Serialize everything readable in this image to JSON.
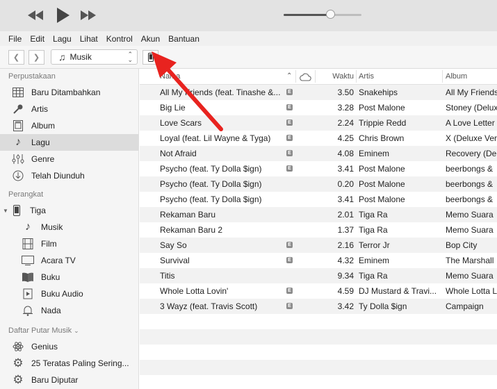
{
  "menu": [
    "File",
    "Edit",
    "Lagu",
    "Lihat",
    "Kontrol",
    "Akun",
    "Bantuan"
  ],
  "volume_level": 0.6,
  "nav": {
    "media_label": "Musik"
  },
  "sidebar": {
    "library_header": "Perpustakaan",
    "library": [
      {
        "label": "Baru Ditambahkan",
        "icon": "grid-icon"
      },
      {
        "label": "Artis",
        "icon": "microphone-icon"
      },
      {
        "label": "Album",
        "icon": "album-icon"
      },
      {
        "label": "Lagu",
        "icon": "music-note-icon",
        "selected": true
      },
      {
        "label": "Genre",
        "icon": "genre-icon"
      },
      {
        "label": "Telah Diunduh",
        "icon": "download-icon"
      }
    ],
    "devices_header": "Perangkat",
    "device_name": "Tiga",
    "device_items": [
      {
        "label": "Musik",
        "icon": "music-note-icon"
      },
      {
        "label": "Film",
        "icon": "film-icon"
      },
      {
        "label": "Acara TV",
        "icon": "tv-icon"
      },
      {
        "label": "Buku",
        "icon": "book-icon"
      },
      {
        "label": "Buku Audio",
        "icon": "audiobook-icon"
      },
      {
        "label": "Nada",
        "icon": "bell-icon"
      }
    ],
    "playlists_header": "Daftar Putar Musik",
    "playlists": [
      {
        "label": "Genius",
        "icon": "atom-icon"
      },
      {
        "label": "25 Teratas Paling Sering...",
        "icon": "gear-icon"
      },
      {
        "label": "Baru Diputar",
        "icon": "gear-icon"
      }
    ]
  },
  "table": {
    "columns": {
      "name": "Nama",
      "time": "Waktu",
      "artist": "Artis",
      "album": "Album"
    },
    "explicit_badge": "E",
    "rows": [
      {
        "name": "All My Friends (feat. Tinashe &...",
        "explicit": true,
        "time": "3.50",
        "artist": "Snakehips",
        "album": "All My Friends"
      },
      {
        "name": "Big Lie",
        "explicit": true,
        "time": "3.28",
        "artist": "Post Malone",
        "album": "Stoney (Delux"
      },
      {
        "name": "Love Scars",
        "explicit": true,
        "time": "2.24",
        "artist": "Trippie Redd",
        "album": "A Love Letter T"
      },
      {
        "name": "Loyal (feat. Lil Wayne & Tyga)",
        "explicit": true,
        "time": "4.25",
        "artist": "Chris Brown",
        "album": "X (Deluxe Vers"
      },
      {
        "name": "Not Afraid",
        "explicit": true,
        "time": "4.08",
        "artist": "Eminem",
        "album": "Recovery (Del"
      },
      {
        "name": "Psycho (feat. Ty Dolla $ign)",
        "explicit": true,
        "time": "3.41",
        "artist": "Post Malone",
        "album": "beerbongs &"
      },
      {
        "name": "Psycho (feat. Ty Dolla $ign)",
        "explicit": false,
        "time": "0.20",
        "artist": "Post Malone",
        "album": "beerbongs &"
      },
      {
        "name": "Psycho (feat. Ty Dolla $ign)",
        "explicit": false,
        "time": "3.41",
        "artist": "Post Malone",
        "album": "beerbongs &"
      },
      {
        "name": "Rekaman Baru",
        "explicit": false,
        "time": "2.01",
        "artist": "Tiga Ra",
        "album": "Memo Suara"
      },
      {
        "name": "Rekaman Baru 2",
        "explicit": false,
        "time": "1.37",
        "artist": "Tiga Ra",
        "album": "Memo Suara"
      },
      {
        "name": "Say So",
        "explicit": true,
        "time": "2.16",
        "artist": "Terror Jr",
        "album": "Bop City"
      },
      {
        "name": "Survival",
        "explicit": true,
        "time": "4.32",
        "artist": "Eminem",
        "album": "The Marshall"
      },
      {
        "name": "Titis",
        "explicit": false,
        "time": "9.34",
        "artist": "Tiga Ra",
        "album": "Memo Suara"
      },
      {
        "name": "Whole Lotta Lovin'",
        "explicit": true,
        "time": "4.59",
        "artist": "DJ Mustard & Travi...",
        "album": "Whole Lotta L"
      },
      {
        "name": "3 Wayz (feat. Travis Scott)",
        "explicit": true,
        "time": "3.42",
        "artist": "Ty Dolla $ign",
        "album": "Campaign"
      }
    ]
  },
  "colors": {
    "accent_arrow": "#e8231f",
    "selected_row": "#dcdcdc"
  }
}
